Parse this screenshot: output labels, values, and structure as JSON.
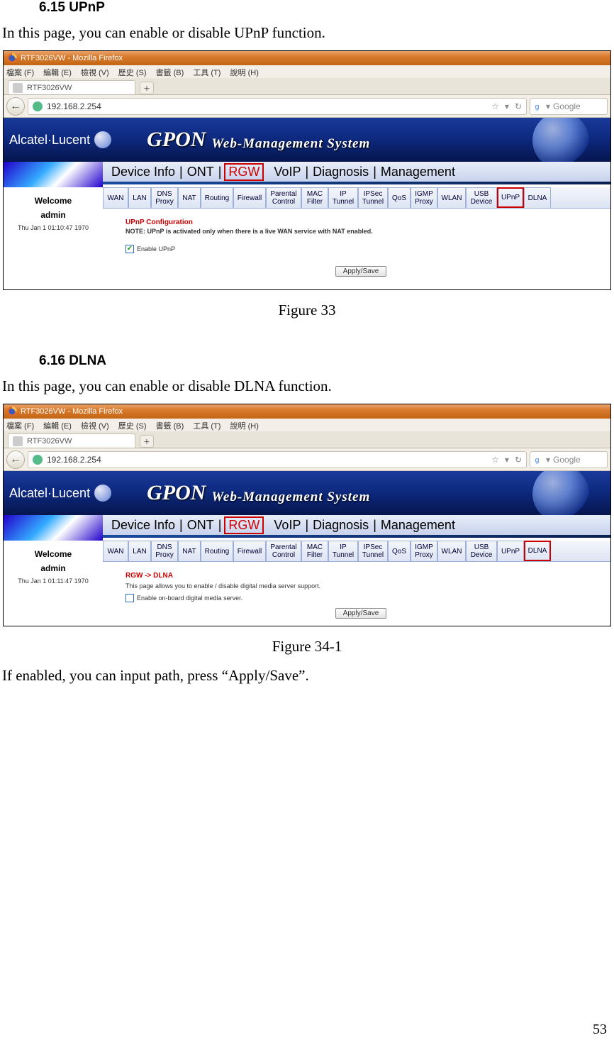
{
  "section_615": {
    "heading": "6.15  UPnP",
    "desc": "In this page, you can enable or disable UPnP function."
  },
  "section_616": {
    "heading": "6.16  DLNA",
    "desc": "In this page, you can enable or disable DLNA function."
  },
  "fig33_caption": "Figure 33",
  "fig34_caption": "Figure 34-1",
  "post_text": "If enabled, you can input path, press “Apply/Save”.",
  "page_number": "53",
  "browser": {
    "title": "RTF3026VW - Mozilla Firefox",
    "menus": [
      "檔案 (F)",
      "編輯 (E)",
      "檢視 (V)",
      "歷史 (S)",
      "書籤 (B)",
      "工具 (T)",
      "說明 (H)"
    ],
    "tab_label": "RTF3026VW",
    "newtab": "+",
    "back_arrow": "←",
    "url": "192.168.2.254",
    "star": "☆",
    "dropdown": "▾",
    "reload": "↻",
    "search_placeholder": "Google"
  },
  "banner": {
    "brand": "Alcatel·Lucent",
    "gpon": "GPON",
    "wms": "Web-Management  System"
  },
  "topnav": {
    "items": [
      "Device Info",
      "ONT",
      "RGW",
      "VoIP",
      "Diagnosis",
      "Management"
    ],
    "sep": "|"
  },
  "sidebar": {
    "welcome": "Welcome",
    "user": "admin",
    "ts1": "Thu Jan 1 01:10:47 1970",
    "ts2": "Thu Jan 1 01:11:47 1970"
  },
  "subnav": {
    "items": [
      {
        "l": "WAN"
      },
      {
        "l": "LAN"
      },
      {
        "l1": "DNS",
        "l2": "Proxy"
      },
      {
        "l": "NAT"
      },
      {
        "l": "Routing"
      },
      {
        "l": "Firewall"
      },
      {
        "l1": "Parental",
        "l2": "Control"
      },
      {
        "l1": "MAC",
        "l2": "Filter"
      },
      {
        "l1": "IP",
        "l2": "Tunnel"
      },
      {
        "l1": "IPSec",
        "l2": "Tunnel"
      },
      {
        "l": "QoS"
      },
      {
        "l1": "IGMP",
        "l2": "Proxy"
      },
      {
        "l": "WLAN"
      },
      {
        "l1": "USB",
        "l2": "Device"
      },
      {
        "l": "UPnP"
      },
      {
        "l": "DLNA"
      }
    ]
  },
  "upnp_panel": {
    "title": "UPnP Configuration",
    "note": "NOTE: UPnP is activated only when there is a live WAN service with NAT enabled.",
    "checkbox_label": "Enable UPnP",
    "apply": "Apply/Save"
  },
  "dlna_panel": {
    "crumb": "RGW -> DLNA",
    "desc": "This page allows you to enable / disable digital media server support.",
    "checkbox_label": "Enable on-board digital media server.",
    "apply": "Apply/Save"
  }
}
